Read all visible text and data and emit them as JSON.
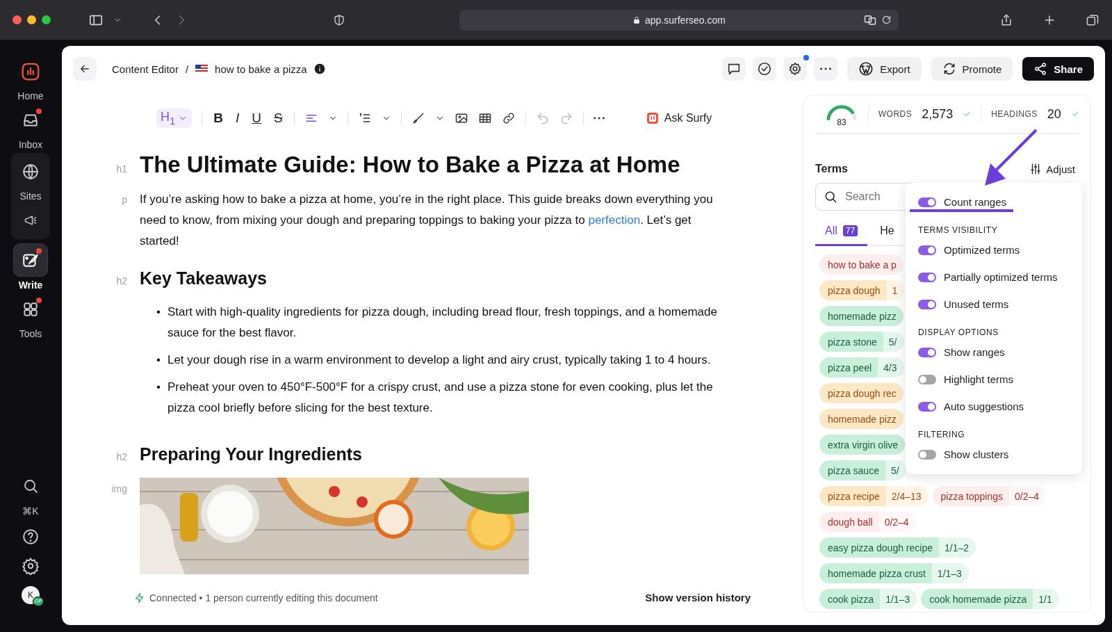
{
  "browser": {
    "url": "app.surferseo.com"
  },
  "sidebar": {
    "items": [
      {
        "label": "Home",
        "selected": false,
        "dot": false
      },
      {
        "label": "Inbox",
        "selected": false,
        "dot": true
      },
      {
        "label": "Sites",
        "selected": false,
        "dot": false
      },
      {
        "label": "Write",
        "selected": true,
        "dot": true
      },
      {
        "label": "Tools",
        "selected": false,
        "dot": true
      }
    ],
    "shortcut": "⌘K",
    "avatar": "K",
    "avatar_badge": "OP"
  },
  "header": {
    "breadcrumb": "Content Editor",
    "separator": "/",
    "document": "how to bake a pizza",
    "export": "Export",
    "promote": "Promote",
    "share": "Share"
  },
  "toolbar": {
    "heading": "H$_{1}$",
    "formats": [
      "B",
      "I",
      "U",
      "S"
    ],
    "ask": "Ask Surfy"
  },
  "document": {
    "blocks": [
      {
        "kind": "h1",
        "tag": "h1",
        "text": "The Ultimate Guide: How to Bake a Pizza at Home"
      },
      {
        "kind": "p",
        "tag": "p",
        "text": "If you’re asking how to bake a pizza at home, you’re in the right place. This guide breaks down everything you need to know, from mixing your dough and preparing toppings to baking your pizza to ",
        "link": "perfection",
        "after": ". Let’s get started!"
      },
      {
        "kind": "h2",
        "tag": "h2",
        "text": "Key Takeaways"
      },
      {
        "kind": "ul",
        "marker": "•",
        "items": [
          "Start with high-quality ingredients for pizza dough, including bread flour, fresh toppings, and a homemade sauce for the best flavor.",
          "Let your dough rise in a warm environment to develop a light and airy crust, typically taking 1 to 4 hours.",
          "Preheat your oven to 450°F-500°F for a crispy crust, and use a pizza stone for even cooking, plus let the pizza cool briefly before slicing for the best texture."
        ]
      },
      {
        "kind": "h2",
        "tag": "h2",
        "text": "Preparing Your Ingredients"
      },
      {
        "kind": "img",
        "tag": "img"
      }
    ]
  },
  "footer": {
    "status": "Connected • 1 person currently editing this document",
    "history": "Show version history"
  },
  "stats": {
    "score": "83",
    "level": 0.83,
    "words_label": "WORDS",
    "words": "2,573",
    "headings_label": "HEADINGS",
    "headings": "20"
  },
  "terms": {
    "title": "Terms",
    "adjust": "Adjust",
    "search": {
      "placeholder": "Search"
    },
    "tabs": [
      {
        "label": "All",
        "count": "77",
        "selected": true
      },
      {
        "label": "He",
        "selected": false
      }
    ],
    "chip_rows": [
      [
        {
          "term": "how to bake a p",
          "color": "#fdeeee"
        }
      ],
      [
        {
          "term": "pizza dough",
          "count": "1",
          "color": "#fde8c6"
        }
      ],
      [
        {
          "term": "homemade pizz",
          "color": "#c8efd9"
        }
      ],
      [
        {
          "term": "pizza stone",
          "count": "5/",
          "color": "#c8efd9"
        }
      ],
      [
        {
          "term": "pizza peel",
          "count": "4/3",
          "color": "#c8efd9"
        }
      ],
      [
        {
          "term": "pizza dough rec",
          "color": "#fde8c6"
        }
      ],
      [
        {
          "term": "homemade pizz",
          "color": "#fde8c6"
        }
      ],
      [
        {
          "term": "extra virgin olive",
          "color": "#c8efd9"
        }
      ],
      [
        {
          "term": "pizza sauce",
          "count": "5/",
          "color": "#c8efd9"
        }
      ],
      [
        {
          "term": "pizza recipe",
          "count": "2/4–13",
          "color": "#fde8c6"
        },
        {
          "term": "pizza toppings",
          "count": "0/2–4",
          "color": "#fdeeee"
        }
      ],
      [
        {
          "term": "dough ball",
          "count": "0/2–4",
          "color": "#fdeeee"
        }
      ],
      [
        {
          "term": "easy pizza dough recipe",
          "count": "1/1–2",
          "color": "#c8efd9"
        }
      ],
      [
        {
          "term": "homemade pizza crust",
          "count": "1/1–3",
          "color": "#c8efd9"
        }
      ],
      [
        {
          "term": "cook pizza",
          "count": "1/1–3",
          "color": "#c8efd9"
        },
        {
          "term": "cook homemade pizza",
          "count": "1/1",
          "color": "#c8efd9"
        }
      ]
    ]
  },
  "adjust_menu": {
    "items": [
      {
        "kind": "toggle",
        "label": "Count ranges",
        "on": true
      },
      {
        "kind": "heading",
        "label": "TERMS VISIBILITY"
      },
      {
        "kind": "toggle",
        "label": "Optimized terms",
        "on": true
      },
      {
        "kind": "toggle",
        "label": "Partially optimized terms",
        "on": true
      },
      {
        "kind": "toggle",
        "label": "Unused terms",
        "on": true
      },
      {
        "kind": "heading",
        "label": "DISPLAY OPTIONS"
      },
      {
        "kind": "toggle",
        "label": "Show ranges",
        "on": true
      },
      {
        "kind": "toggle",
        "label": "Highlight terms",
        "on": false
      },
      {
        "kind": "toggle",
        "label": "Auto suggestions",
        "on": true
      },
      {
        "kind": "heading",
        "label": "FILTERING"
      },
      {
        "kind": "toggle",
        "label": "Show clusters",
        "on": false
      }
    ]
  }
}
